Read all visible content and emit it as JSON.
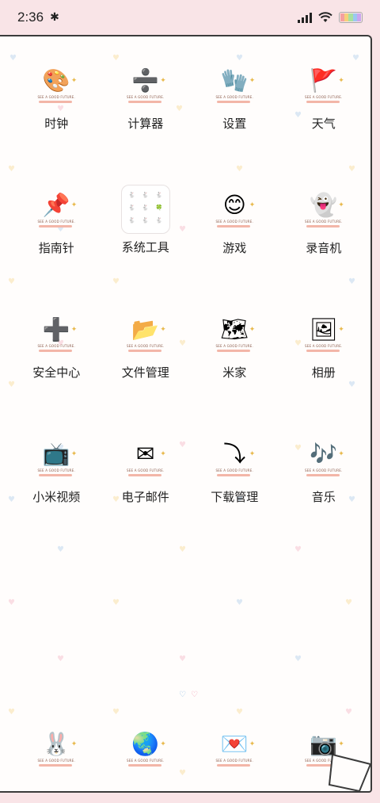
{
  "status_bar": {
    "time": "2:36",
    "bluetooth_icon": "bluetooth-icon",
    "signal_icon": "signal-icon",
    "wifi_icon": "wifi-icon",
    "battery_icon": "battery-icon"
  },
  "icon_tagline": "SEE A GOOD FUTURE.",
  "apps": [
    {
      "label": "时钟",
      "icon": "palette-icon",
      "glyph": "🎨"
    },
    {
      "label": "计算器",
      "icon": "calculator-icon",
      "glyph": "➗"
    },
    {
      "label": "设置",
      "icon": "glove-icon",
      "glyph": "🧤"
    },
    {
      "label": "天气",
      "icon": "flag-icon",
      "glyph": "🚩"
    },
    {
      "label": "指南针",
      "icon": "pushpin-icon",
      "glyph": "📌"
    },
    {
      "label": "系统工具",
      "icon": "folder-icon",
      "glyph": ""
    },
    {
      "label": "游戏",
      "icon": "smiley-icon",
      "glyph": "😊"
    },
    {
      "label": "录音机",
      "icon": "ghost-icon",
      "glyph": "👻"
    },
    {
      "label": "安全中心",
      "icon": "plus-icon",
      "glyph": "➕"
    },
    {
      "label": "文件管理",
      "icon": "file-folder-icon",
      "glyph": "📂"
    },
    {
      "label": "米家",
      "icon": "map-icon",
      "glyph": "🗺"
    },
    {
      "label": "相册",
      "icon": "photos-icon",
      "glyph": "🖼"
    },
    {
      "label": "小米视频",
      "icon": "tv-icon",
      "glyph": "📺"
    },
    {
      "label": "电子邮件",
      "icon": "envelope-icon",
      "glyph": "✉"
    },
    {
      "label": "下载管理",
      "icon": "download-icon",
      "glyph": "⤵"
    },
    {
      "label": "音乐",
      "icon": "music-icon",
      "glyph": "🎶"
    }
  ],
  "dock": [
    {
      "icon": "rabbit-phone-icon",
      "glyph": "🐰"
    },
    {
      "icon": "globe-icon",
      "glyph": "🌏"
    },
    {
      "icon": "message-envelope-icon",
      "glyph": "💌"
    },
    {
      "icon": "camera-icon",
      "glyph": "📷"
    }
  ],
  "page_indicator": {
    "pages": 2,
    "current": 1
  },
  "colors": {
    "background": "#f9e4e7",
    "paper": "#fffdfc",
    "accent_pink": "#f3b6a8",
    "dot_blue": "#9cc3e6",
    "dot_pink": "#f2a5b8"
  }
}
